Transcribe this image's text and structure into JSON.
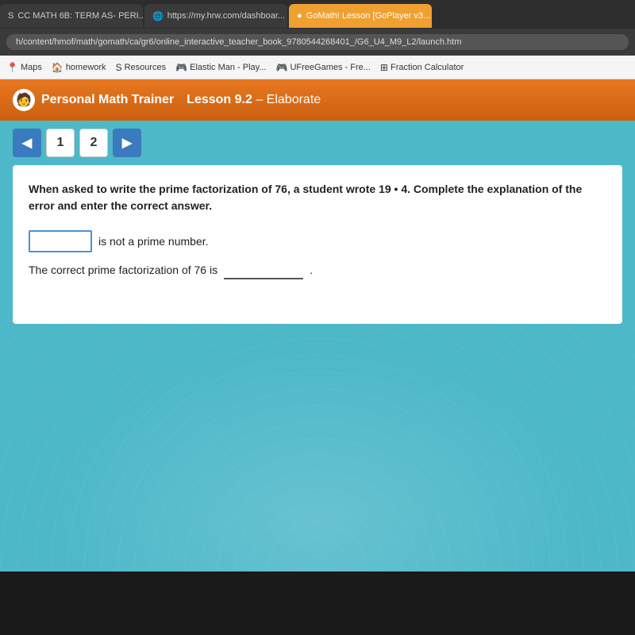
{
  "browser": {
    "tabs": [
      {
        "id": "tab1",
        "label": "CC MATH 6B: TERM AS- PERI...",
        "icon": "S",
        "active": false,
        "close": "x"
      },
      {
        "id": "tab2",
        "label": "https://my.hrw.com/dashboar...",
        "icon": "🌐",
        "active": false,
        "close": "x"
      },
      {
        "id": "tab3",
        "label": "GoMath! Lesson [GoPlayer v3...",
        "icon": "●",
        "active": true,
        "close": "x"
      }
    ],
    "address": "h/content/hmof/math/gomath/ca/gr6/online_interactive_teacher_book_9780544268401_/G6_U4_M9_L2/launch.htm",
    "bookmarks": [
      {
        "id": "bm1",
        "icon": "📍",
        "label": "Maps"
      },
      {
        "id": "bm2",
        "icon": "🏠",
        "label": "homework"
      },
      {
        "id": "bm3",
        "icon": "S",
        "label": "Resources"
      },
      {
        "id": "bm4",
        "icon": "🎮",
        "label": "Elastic Man - Play..."
      },
      {
        "id": "bm5",
        "icon": "🎮",
        "label": "UFreeGames - Fre..."
      },
      {
        "id": "bm6",
        "icon": "⊞",
        "label": "Fraction Calculator"
      }
    ]
  },
  "header": {
    "app_name": "Personal Math Trainer",
    "lesson_prefix": "Lesson 9.2",
    "lesson_suffix": "– Elaborate"
  },
  "navigation": {
    "prev_label": "◀",
    "page1_label": "1",
    "page2_label": "2",
    "next_label": "▶"
  },
  "question": {
    "text": "When asked to write the prime factorization of 76, a student wrote 19 • 4. Complete the explanation of the error and enter the correct answer.",
    "line1_suffix": "is not a prime number.",
    "line2_prefix": "The correct prime factorization of 76 is",
    "line2_suffix": ".",
    "input1_placeholder": "",
    "input2_placeholder": ""
  }
}
